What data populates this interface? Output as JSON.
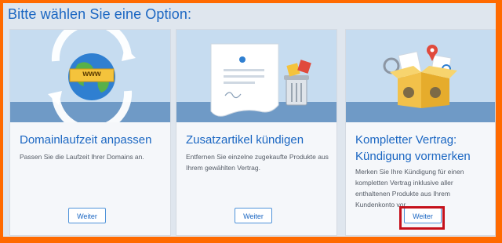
{
  "page": {
    "title": "Bitte wählen Sie eine Option:"
  },
  "cards": [
    {
      "title": "Domainlaufzeit anpassen",
      "description": "Passen Sie die Laufzeit Ihrer Domains an.",
      "button_label": "Weiter",
      "illustration_text": "www",
      "illustration_icon": "globe-icon"
    },
    {
      "title": "Zusatzartikel kündigen",
      "description": "Entfernen Sie einzelne zugekaufte Produkte aus Ihrem gewählten Vertrag.",
      "button_label": "Weiter",
      "illustration_icon": "document-trash-icon"
    },
    {
      "title": "Kompletter Vertrag: Kündigung vormerken",
      "description": "Merken Sie Ihre Kündigung für einen kompletten Vertrag inklusive aller enthaltenen Produkte aus Ihrem Kundenkonto vor.",
      "button_label": "Weiter",
      "illustration_icon": "box-icon"
    }
  ],
  "colors": {
    "frame": "#ff6a00",
    "accent": "#1a66c2",
    "highlight": "#c5111b"
  }
}
